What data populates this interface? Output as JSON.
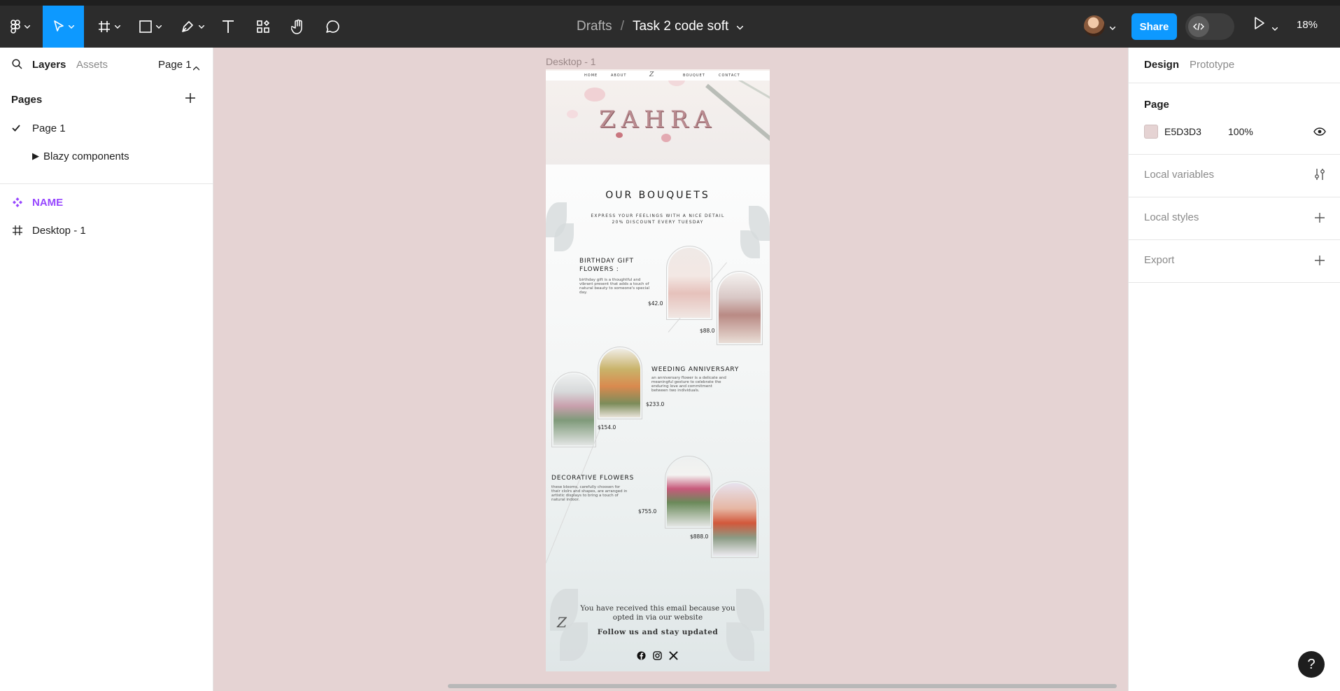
{
  "toolbar": {
    "breadcrumb_drafts": "Drafts",
    "breadcrumb_sep": "/",
    "file_name": "Task 2 code soft",
    "share_label": "Share",
    "zoom_level": "18%"
  },
  "left_panel": {
    "tab_layers": "Layers",
    "tab_assets": "Assets",
    "current_page": "Page 1",
    "pages_heading": "Pages",
    "pages": [
      {
        "label": "Page 1",
        "selected": true
      },
      {
        "label": "Blazy components",
        "selected": false
      }
    ],
    "layers": [
      {
        "label": "NAME",
        "type": "component"
      },
      {
        "label": "Desktop - 1",
        "type": "frame"
      }
    ]
  },
  "canvas": {
    "frame_label": "Desktop - 1",
    "email": {
      "nav": [
        "HOME",
        "ABOUT",
        "BOUQUET",
        "CONTACT"
      ],
      "hero_title": "ZAHRA",
      "section_title": "OUR BOUQUETS",
      "section_sub_1": "EXPRESS YOUR FEELINGS WITH A NICE DETAIL",
      "section_sub_2": "20% DISCOUNT EVERY TUESDAY",
      "categories": [
        {
          "title_1": "BIRTHDAY GIFT",
          "title_2": "FLOWERS :",
          "desc": "birthday gift is a thoughtful and vibrant present that adds a touch of natural beauty to someone's special day.",
          "prices": [
            "$42.0",
            "$88.0"
          ]
        },
        {
          "title_1": "WEEDING ANNIVERSARY",
          "desc": "an anniversary flower is a delicate and meaningful gesture to celebrate the enduring love and commitment between two individuals.",
          "prices": [
            "$233.0",
            "$154.0"
          ]
        },
        {
          "title_1": "DECORATIVE  FLOWERS",
          "desc": "these blooms, carefully choosen for their clolrs and shapes, are arranged in artistic displays  to bring a touch of natural indoor.",
          "prices": [
            "$755.0",
            "$888.0"
          ]
        }
      ],
      "footer_line_1": "You have received this email because you",
      "footer_line_2": "opted in via our website",
      "footer_follow": "Follow us and stay updated",
      "social_icons": [
        "facebook-icon",
        "instagram-icon",
        "x-icon"
      ]
    }
  },
  "right_panel": {
    "tab_design": "Design",
    "tab_prototype": "Prototype",
    "page_heading": "Page",
    "page_color": "E5D3D3",
    "page_opacity": "100%",
    "local_variables": "Local variables",
    "local_styles": "Local styles",
    "export": "Export"
  },
  "colors": {
    "accent": "#0d99ff",
    "canvas_bg": "#e5d3d3",
    "component": "#9747ff",
    "toolbar_bg": "#2c2c2c"
  },
  "help_label": "?"
}
